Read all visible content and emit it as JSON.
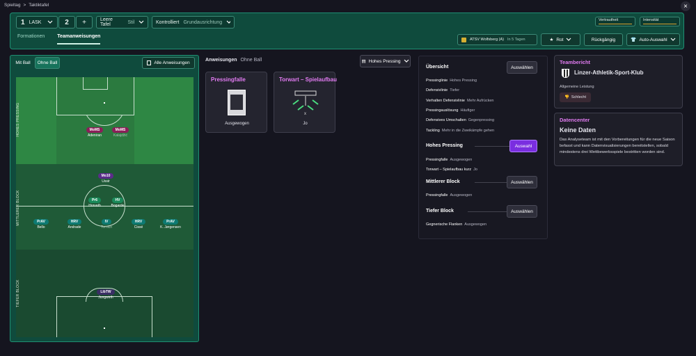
{
  "breadcrumb": {
    "parent": "Spieltag",
    "sep": ">",
    "current": "Taktiktafel"
  },
  "close_icon": "×",
  "topbar": {
    "tactic_num": "1",
    "team": "LASK",
    "tactic2": "2",
    "add": "+",
    "style": {
      "label": "Leere Tafel",
      "sub": "Stil"
    },
    "mentality": {
      "label": "Kontrolliert",
      "sub": "Grundausrichtung"
    },
    "familiarity": "Vertrautheit",
    "intensity": "Intensität",
    "tabs": [
      {
        "label": "Formationen"
      },
      {
        "label": "Teamanweisungen"
      }
    ],
    "opponent": {
      "name": "ATSV Wolfsberg (A)",
      "when": "In 5 Tagen"
    },
    "mode": "Rot",
    "undo": "Rückgängig",
    "auto": "Auto-Auswahl"
  },
  "pitch_panel": {
    "with_ball": "Mit Ball",
    "without_ball": "Ohne Ball",
    "all_instructions": "Alle Anweisungen",
    "zones": [
      "HOHES PRESSING",
      "MITTLERER BLOCK",
      "TIEFER BLOCK"
    ],
    "players": [
      {
        "role": "MoMS",
        "name": "Adeniran",
        "color": "#8a1f59",
        "muted": false
      },
      {
        "role": "MoMS",
        "name": "Kalajdžić",
        "color": "#8a1f59",
        "muted": true
      },
      {
        "role": "Mo10",
        "name": "Ussir",
        "color": "#5b2c8a",
        "muted": false
      },
      {
        "role": "Pr6",
        "name": "Horvath",
        "color": "#1a8a5a",
        "muted": false
      },
      {
        "role": "HV",
        "name": "Bogarde",
        "color": "#1a8a5a",
        "muted": false
      },
      {
        "role": "PrAV",
        "name": "Bello",
        "color": "#0e7a72",
        "muted": false
      },
      {
        "role": "HRV",
        "name": "Andrade",
        "color": "#0e7a72",
        "muted": false
      },
      {
        "role": "IV",
        "name": "Tornich",
        "color": "#0e7a72",
        "muted": true
      },
      {
        "role": "HRV",
        "name": "Cissé",
        "color": "#0e7a72",
        "muted": false
      },
      {
        "role": "PrAV",
        "name": "K. Jørgensen",
        "color": "#0e7a72",
        "muted": false
      },
      {
        "role": "LibTW",
        "name": "Jungwirth",
        "color": "#3a2f64",
        "muted": false
      }
    ]
  },
  "instructions": {
    "title": "Anweisungen",
    "sub": "Ohne Ball",
    "dropdown": "Hohes Pressing",
    "cards": [
      {
        "title": "Pressingfalle",
        "value": "Ausgewogen"
      },
      {
        "title": "Torwart – Spielaufbau",
        "value": "Jo"
      }
    ]
  },
  "overview": {
    "title": "Übersicht",
    "btn": "Auswählen",
    "rows": [
      {
        "k": "Pressinglinie",
        "v": "Hohes Pressing"
      },
      {
        "k": "Defensivlinie",
        "v": "Tiefer"
      },
      {
        "k": "Verhalten Defensivlinie",
        "v": "Mehr Aufrücken"
      },
      {
        "k": "Pressingauslösung",
        "v": "Häufiger"
      },
      {
        "k": "Defensives Umschalten",
        "v": "Gegenpressing"
      },
      {
        "k": "Tackling",
        "v": "Mehr in die Zweikämpfe gehen"
      }
    ],
    "high": {
      "title": "Hohes Pressing",
      "btn": "Auswahl",
      "rows": [
        {
          "k": "Pressingfalle",
          "v": "Ausgewogen"
        },
        {
          "k": "Torwart – Spielaufbau kurz",
          "v": "Jo"
        }
      ]
    },
    "mid": {
      "title": "Mittlerer Block",
      "btn": "Auswählen",
      "rows": [
        {
          "k": "Pressingfalle",
          "v": "Ausgewogen"
        }
      ]
    },
    "low": {
      "title": "Tiefer Block",
      "btn": "Auswählen",
      "rows": [
        {
          "k": "Gegnerische Flanken",
          "v": "Ausgewogen"
        }
      ]
    }
  },
  "team_report": {
    "header": "Teambericht",
    "club": "Linzer-Athletik-Sport-Klub",
    "sub": "Allgemeine Leistung",
    "badge": "Schlecht"
  },
  "datacenter": {
    "header": "Datencenter",
    "title": "Keine Daten",
    "text": "Das Analyseteam ist mit den Vorbereitungen für die neue Saison befasst und kann Datenvisualisierungen bereitstellen, sobald mindestens drei Wettbewerbsspiele bestritten worden sind."
  },
  "colors": {
    "accent": "#1f8f73",
    "panel": "#0f4b3d",
    "pitch": "#1e4f32",
    "purple": "#7a2ee0",
    "pink": "#e27bf2"
  }
}
